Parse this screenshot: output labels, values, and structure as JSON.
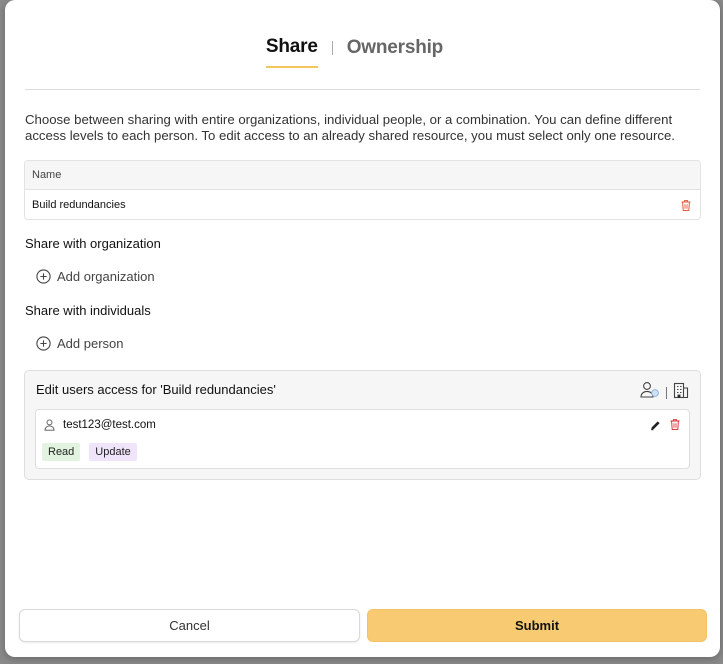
{
  "tabs": {
    "share": "Share",
    "ownership": "Ownership"
  },
  "description": "Choose between sharing with entire organizations, individual people, or a combination. You can define different access levels to each person. To edit access to an already shared resource, you must select only one resource.",
  "table": {
    "header": "Name",
    "rows": [
      {
        "name": "Build redundancies",
        "action_icon": "trash-icon"
      }
    ]
  },
  "organization": {
    "label": "Share with organization",
    "add_label": "Add organization"
  },
  "individuals": {
    "label": "Share with individuals",
    "add_label": "Add person"
  },
  "access_panel": {
    "title": "Edit users access for 'Build redundancies'",
    "user": {
      "email": "test123@test.com",
      "permissions": [
        "Read",
        "Update"
      ]
    }
  },
  "buttons": {
    "cancel": "Cancel",
    "submit": "Submit"
  },
  "colors": {
    "accent": "#f8cb72",
    "trash": "#e05a3b",
    "read_badge": "#e2f4df",
    "update_badge": "#f0e4fb"
  }
}
